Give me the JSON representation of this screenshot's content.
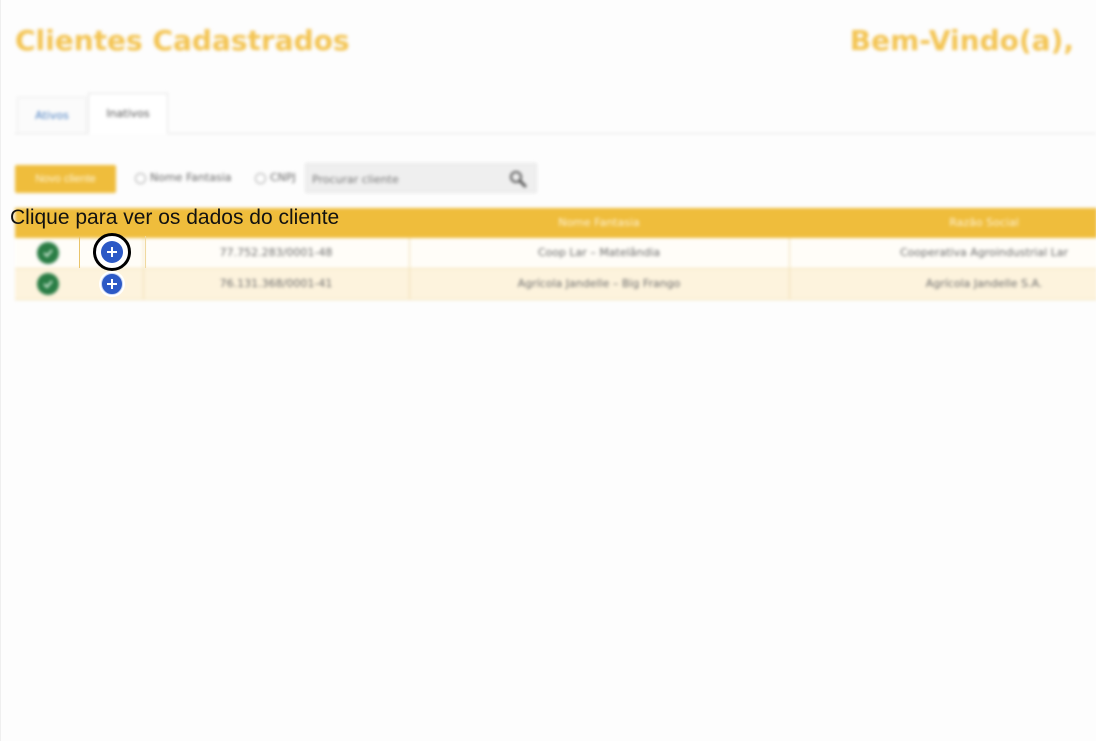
{
  "header": {
    "title": "Clientes Cadastrados",
    "welcome": "Bem-Vindo(a),"
  },
  "tabs": [
    {
      "label": "Ativos"
    },
    {
      "label": "Inativos"
    }
  ],
  "toolbar": {
    "new_client_label": "Novo cliente",
    "radio_options": [
      {
        "label": "Nome Fantasia"
      },
      {
        "label": "CNPJ"
      }
    ],
    "search_placeholder": "Procurar cliente"
  },
  "table": {
    "columns": [
      "",
      "",
      "",
      "Nome Fantasia",
      "Razão Social"
    ],
    "rows": [
      {
        "cnpj": "77.752.283/0001-48",
        "nome_fantasia": "Coop Lar – Matelândia",
        "razao_social": "Cooperativa Agroindustrial Lar"
      },
      {
        "cnpj": "76.131.368/0001-41",
        "nome_fantasia": "Agrícola Jandelle – Big Frango",
        "razao_social": "Agrícola Jandelle S.A."
      }
    ]
  },
  "callout": {
    "text": "Clique para ver os dados do cliente"
  },
  "colors": {
    "accent": "#efbd3c",
    "title": "#f3c453",
    "status_active": "#2a7d45",
    "add_button": "#2c59c6"
  },
  "icons": {
    "status": "check-circle-icon",
    "details": "plus-circle-icon",
    "search": "magnifier-icon"
  }
}
